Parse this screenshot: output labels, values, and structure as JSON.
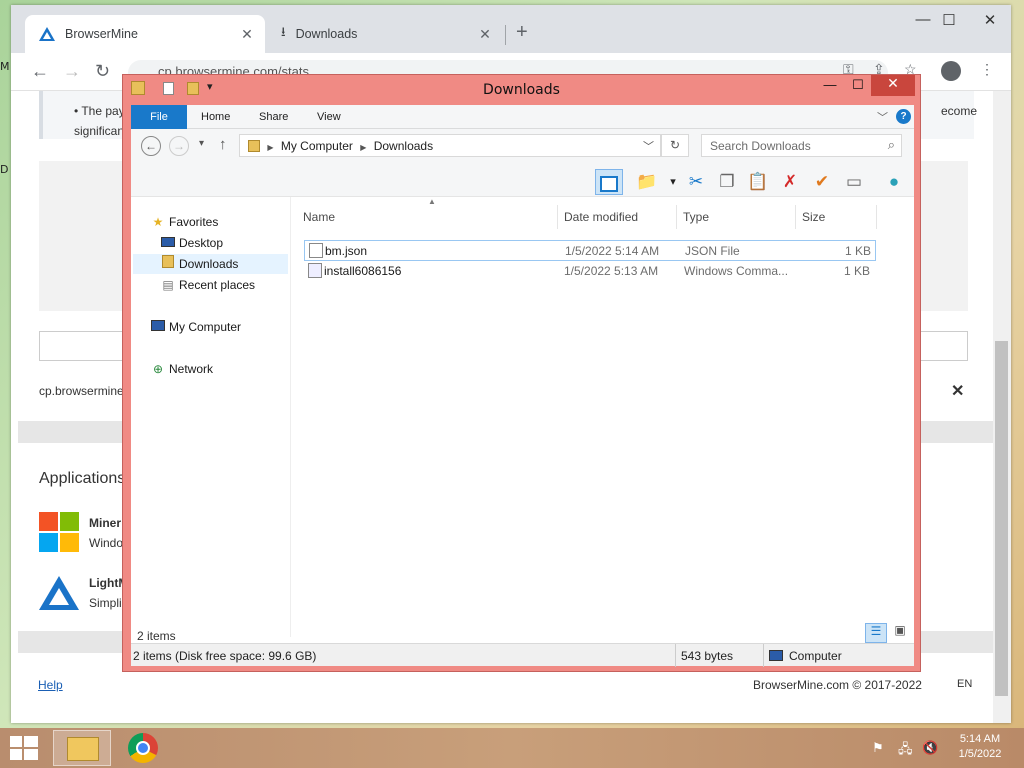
{
  "desktop": {
    "left_chars": [
      "M",
      "D"
    ]
  },
  "chrome": {
    "tabs": [
      {
        "label": "BrowserMine",
        "active": true
      },
      {
        "label": "Downloads",
        "active": false
      }
    ],
    "url": "cp.browsermine.com/stats",
    "window_controls": {
      "minimize": "—",
      "maximize": "☐",
      "close": "✕"
    }
  },
  "page": {
    "bullet_text": "The paym",
    "bullet_text_right": "ecome",
    "line2": "significan",
    "url_label": "cp.browsermine",
    "close_x": "✕",
    "applications_heading": "Applications",
    "apps": [
      {
        "name": "Miner",
        "sub": "Windo"
      },
      {
        "name": "LightM",
        "sub": "Simpli"
      }
    ],
    "help_link": "Help",
    "copyright": "BrowserMine.com © 2017-2022",
    "lang": "EN"
  },
  "explorer": {
    "title": "Downloads",
    "ribbon_tabs": [
      "File",
      "Home",
      "Share",
      "View"
    ],
    "breadcrumb": [
      "My Computer",
      "Downloads"
    ],
    "search_placeholder": "Search Downloads",
    "nav": {
      "favorites": "Favorites",
      "desktop": "Desktop",
      "downloads": "Downloads",
      "recent": "Recent places",
      "computer": "My Computer",
      "network": "Network"
    },
    "columns": [
      "Name",
      "Date modified",
      "Type",
      "Size"
    ],
    "files": [
      {
        "name": "bm.json",
        "date": "1/5/2022 5:14 AM",
        "type": "JSON File",
        "size": "1 KB",
        "icon": "document-icon"
      },
      {
        "name": "install6086156",
        "date": "1/5/2022 5:13 AM",
        "type": "Windows Comma...",
        "size": "1 KB",
        "icon": "script-icon"
      }
    ],
    "item_count": "2 items",
    "status_left": "2 items (Disk free space: 99.6 GB)",
    "status_size": "543 bytes",
    "status_location": "Computer"
  },
  "taskbar": {
    "time": "5:14 AM",
    "date": "1/5/2022"
  }
}
